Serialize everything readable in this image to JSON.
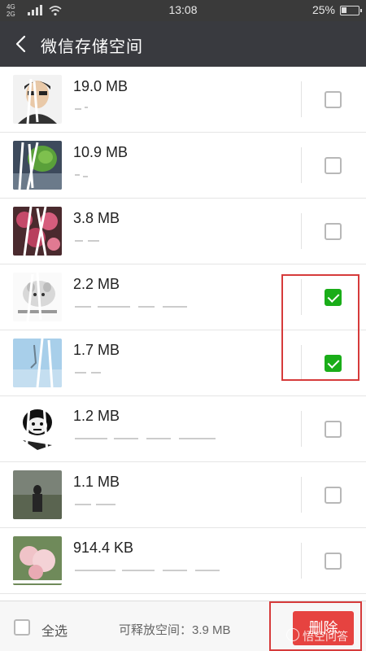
{
  "status_bar": {
    "network": "4G\n2G",
    "time": "13:08",
    "battery": "25%"
  },
  "header": {
    "title": "微信存储空间"
  },
  "items": [
    {
      "size": "19.0 MB",
      "checked": false,
      "thumb": "portrait"
    },
    {
      "size": "10.9 MB",
      "checked": false,
      "thumb": "plant"
    },
    {
      "size": "3.8 MB",
      "checked": false,
      "thumb": "flowers"
    },
    {
      "size": "2.2 MB",
      "checked": true,
      "thumb": "cartoon"
    },
    {
      "size": "1.7 MB",
      "checked": true,
      "thumb": "sky"
    },
    {
      "size": "1.2 MB",
      "checked": false,
      "thumb": "meme"
    },
    {
      "size": "1.1 MB",
      "checked": false,
      "thumb": "field"
    },
    {
      "size": "914.4 KB",
      "checked": false,
      "thumb": "blossom"
    }
  ],
  "bottom_bar": {
    "select_all_label": "全选",
    "free_space_label": "可释放空间：3.9 MB",
    "delete_label": "删除"
  },
  "watermark": "悟空问答",
  "colors": {
    "nav_bg": "#393a3f",
    "status_bg": "#3a3a3a",
    "check_green": "#1aad19",
    "delete_red": "#e64340",
    "annotation_red": "#d63b3b"
  }
}
